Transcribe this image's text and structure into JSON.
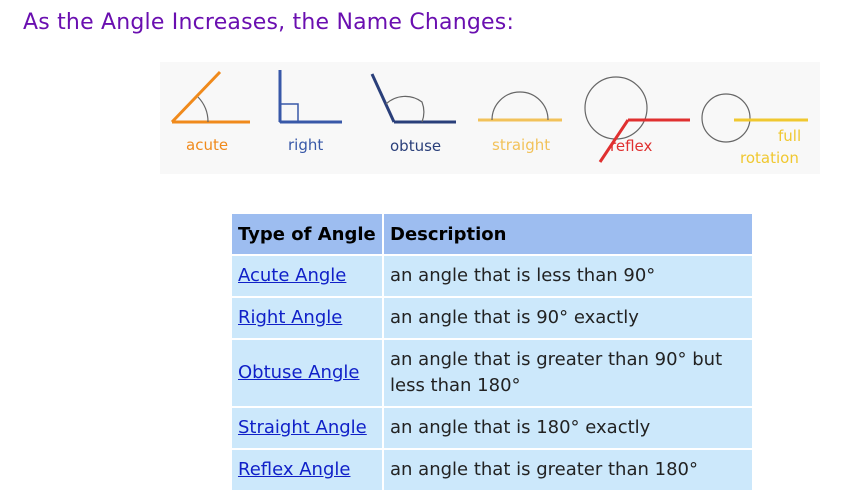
{
  "heading": "As the Angle Increases, the Name Changes:",
  "figure": {
    "labels": {
      "acute": "acute",
      "right": "right",
      "obtuse": "obtuse",
      "straight": "straight",
      "reflex": "reflex",
      "full_line1": "full",
      "full_line2": "rotation"
    },
    "colors": {
      "acute": "#f08a1c",
      "right": "#3858a8",
      "obtuse": "#2a3f7a",
      "straight": "#f2c25a",
      "reflex": "#e03030",
      "full": "#f0c830",
      "arc": "#666666"
    }
  },
  "table": {
    "headers": [
      "Type of Angle",
      "Description"
    ],
    "rows": [
      {
        "name": "Acute Angle",
        "description": "an angle that is less than 90°"
      },
      {
        "name": "Right Angle",
        "description": "an angle that is 90° exactly"
      },
      {
        "name": "Obtuse Angle",
        "description": "an angle that is greater than 90° but less than 180°"
      },
      {
        "name": "Straight Angle",
        "description": "an angle that is 180° exactly"
      },
      {
        "name": "Reflex Angle",
        "description": "an angle that is greater than 180°"
      }
    ]
  },
  "colors": {
    "heading": "#6a0fb0",
    "header_bg": "#9dbdf0",
    "cell_bg": "#cce8fb",
    "link": "#1020c8"
  }
}
